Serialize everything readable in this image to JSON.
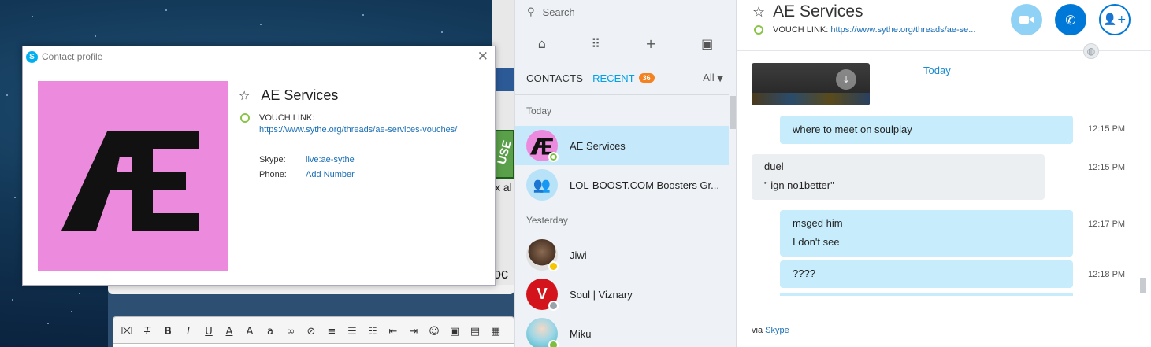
{
  "profile_window": {
    "title": "Contact profile",
    "close_icon": "close-icon",
    "avatar_letters": "ÆE",
    "avatar_bg": "#ec8bdd",
    "name": "AE Services",
    "mood_label": "VOUCH LINK:",
    "mood_url": "https://www.sythe.org/threads/ae-services-vouches/",
    "skype_label": "Skype:",
    "skype_value": "live:ae-sythe",
    "phone_label": "Phone:",
    "phone_value": "Add Number"
  },
  "contacts_pane": {
    "search_placeholder": "Search",
    "tab_contacts": "CONTACTS",
    "tab_recent": "RECENT",
    "recent_badge": "36",
    "filter": "All",
    "groups": [
      {
        "label": "Today",
        "items": [
          {
            "name": "AE Services",
            "selected": true,
            "status": "online"
          },
          {
            "name": "LOL-BOOST.COM Boosters Gr...",
            "selected": false,
            "status": "group"
          }
        ]
      },
      {
        "label": "Yesterday",
        "items": [
          {
            "name": "Jiwi",
            "selected": false,
            "status": "away"
          },
          {
            "name": "Soul | Viznary",
            "selected": false,
            "status": "unknown"
          },
          {
            "name": "Miku",
            "selected": false,
            "status": "online"
          }
        ]
      }
    ]
  },
  "conversation": {
    "title": "AE Services",
    "mood_label": "VOUCH LINK:",
    "mood_url": "https://www.sythe.org/threads/ae-se...",
    "today_label": "Today",
    "messages": [
      {
        "direction": "out",
        "lines": [
          "where to meet on soulplay"
        ],
        "time": "12:15 PM"
      },
      {
        "direction": "in",
        "lines": [
          "duel",
          "\" ign no1better\""
        ],
        "time": "12:15 PM"
      },
      {
        "direction": "out",
        "lines": [
          "msged him",
          "I don't see"
        ],
        "time": "12:17 PM"
      },
      {
        "direction": "out",
        "lines": [
          "????"
        ],
        "time": "12:18 PM"
      }
    ],
    "via_prefix": "via",
    "via_link": "Skype",
    "colors": {
      "accent": "#00a0e6",
      "call": "#0078d7",
      "badge": "#f58220"
    }
  },
  "background": {
    "forum_thumb_text": "USE",
    "forum_snippet": "x al",
    "forum_snippet2": "oc"
  }
}
